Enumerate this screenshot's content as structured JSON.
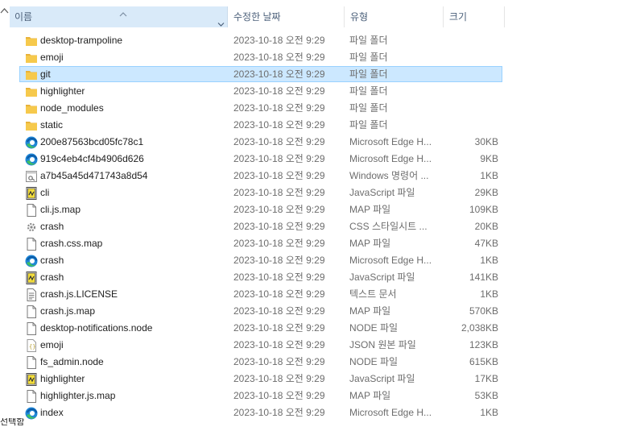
{
  "columns": {
    "name": "이름",
    "date": "수정한 날짜",
    "type": "유형",
    "size": "크기"
  },
  "files": [
    {
      "name": "desktop-trampoline",
      "date": "2023-10-18 오전 9:29",
      "type": "파일 폴더",
      "size": "",
      "icon": "folder-icon",
      "selected": false
    },
    {
      "name": "emoji",
      "date": "2023-10-18 오전 9:29",
      "type": "파일 폴더",
      "size": "",
      "icon": "folder-icon",
      "selected": false
    },
    {
      "name": "git",
      "date": "2023-10-18 오전 9:29",
      "type": "파일 폴더",
      "size": "",
      "icon": "folder-icon",
      "selected": true
    },
    {
      "name": "highlighter",
      "date": "2023-10-18 오전 9:29",
      "type": "파일 폴더",
      "size": "",
      "icon": "folder-icon",
      "selected": false
    },
    {
      "name": "node_modules",
      "date": "2023-10-18 오전 9:29",
      "type": "파일 폴더",
      "size": "",
      "icon": "folder-icon",
      "selected": false
    },
    {
      "name": "static",
      "date": "2023-10-18 오전 9:29",
      "type": "파일 폴더",
      "size": "",
      "icon": "folder-icon",
      "selected": false
    },
    {
      "name": "200e87563bcd05fc78c1",
      "date": "2023-10-18 오전 9:29",
      "type": "Microsoft Edge H...",
      "size": "30KB",
      "icon": "edge-icon",
      "selected": false
    },
    {
      "name": "919c4eb4cf4b4906d626",
      "date": "2023-10-18 오전 9:29",
      "type": "Microsoft Edge H...",
      "size": "9KB",
      "icon": "edge-icon",
      "selected": false
    },
    {
      "name": "a7b45a45d471743a8d54",
      "date": "2023-10-18 오전 9:29",
      "type": "Windows 명령어 ...",
      "size": "1KB",
      "icon": "cmd-file-icon",
      "selected": false
    },
    {
      "name": "cli",
      "date": "2023-10-18 오전 9:29",
      "type": "JavaScript 파일",
      "size": "29KB",
      "icon": "javascript-file-icon",
      "selected": false
    },
    {
      "name": "cli.js.map",
      "date": "2023-10-18 오전 9:29",
      "type": "MAP 파일",
      "size": "109KB",
      "icon": "blank-file-icon",
      "selected": false
    },
    {
      "name": "crash",
      "date": "2023-10-18 오전 9:29",
      "type": "CSS 스타일시트 ...",
      "size": "20KB",
      "icon": "css-file-icon",
      "selected": false
    },
    {
      "name": "crash.css.map",
      "date": "2023-10-18 오전 9:29",
      "type": "MAP 파일",
      "size": "47KB",
      "icon": "blank-file-icon",
      "selected": false
    },
    {
      "name": "crash",
      "date": "2023-10-18 오전 9:29",
      "type": "Microsoft Edge H...",
      "size": "1KB",
      "icon": "edge-icon",
      "selected": false
    },
    {
      "name": "crash",
      "date": "2023-10-18 오전 9:29",
      "type": "JavaScript 파일",
      "size": "141KB",
      "icon": "javascript-file-icon",
      "selected": false
    },
    {
      "name": "crash.js.LICENSE",
      "date": "2023-10-18 오전 9:29",
      "type": "텍스트 문서",
      "size": "1KB",
      "icon": "text-file-icon",
      "selected": false
    },
    {
      "name": "crash.js.map",
      "date": "2023-10-18 오전 9:29",
      "type": "MAP 파일",
      "size": "570KB",
      "icon": "blank-file-icon",
      "selected": false
    },
    {
      "name": "desktop-notifications.node",
      "date": "2023-10-18 오전 9:29",
      "type": "NODE 파일",
      "size": "2,038KB",
      "icon": "blank-file-icon",
      "selected": false
    },
    {
      "name": "emoji",
      "date": "2023-10-18 오전 9:29",
      "type": "JSON 원본 파일",
      "size": "123KB",
      "icon": "json-file-icon",
      "selected": false
    },
    {
      "name": "fs_admin.node",
      "date": "2023-10-18 오전 9:29",
      "type": "NODE 파일",
      "size": "615KB",
      "icon": "blank-file-icon",
      "selected": false
    },
    {
      "name": "highlighter",
      "date": "2023-10-18 오전 9:29",
      "type": "JavaScript 파일",
      "size": "17KB",
      "icon": "javascript-file-icon",
      "selected": false
    },
    {
      "name": "highlighter.js.map",
      "date": "2023-10-18 오전 9:29",
      "type": "MAP 파일",
      "size": "53KB",
      "icon": "blank-file-icon",
      "selected": false
    },
    {
      "name": "index",
      "date": "2023-10-18 오전 9:29",
      "type": "Microsoft Edge H...",
      "size": "1KB",
      "icon": "edge-icon",
      "selected": false
    }
  ],
  "status": {
    "text": "선택함"
  },
  "colors": {
    "selection_bg": "#cce8ff",
    "selection_border": "#99d1ff",
    "header_active_bg": "#d9eaf9",
    "folder": "#f3c143",
    "edge_blue": "#0c59a4",
    "edge_green": "#4bc564"
  }
}
